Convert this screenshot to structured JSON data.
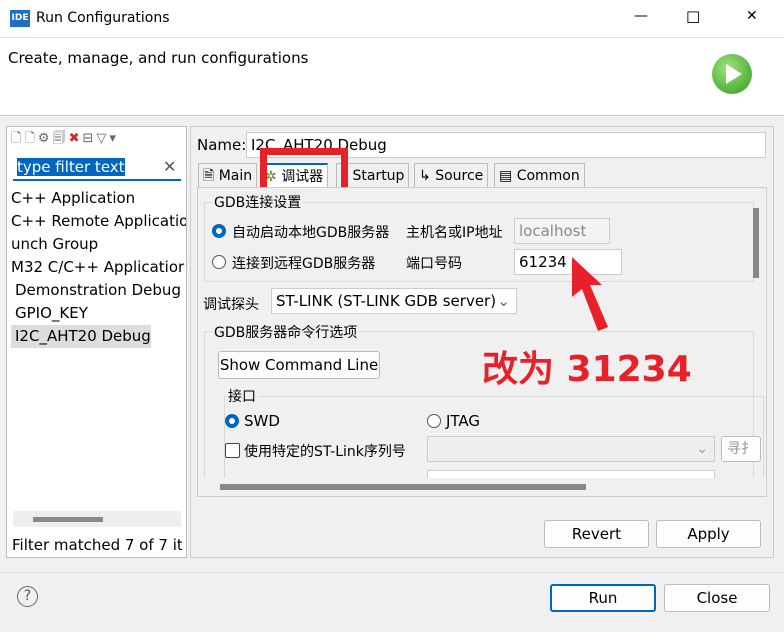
{
  "window": {
    "title": "Run Configurations",
    "icon": "IDE",
    "minimize": "—",
    "maximize": "☐",
    "close": "✕"
  },
  "banner": {
    "text": "Create, manage, and run configurations",
    "icon": "run-icon"
  },
  "sidebar": {
    "filter_placeholder": "type filter text",
    "filter_value": "type filter text",
    "items": [
      "C++ Application",
      "C++ Remote Applicatio",
      "unch Group",
      "M32 C/C++ Applicatior",
      "Demonstration Debug",
      "GPIO_KEY",
      "I2C_AHT20 Debug"
    ],
    "status": "Filter matched 7 of 7 ite"
  },
  "name": {
    "label": "Name:",
    "value": "I2C_AHT20 Debug"
  },
  "tabs": [
    "Main",
    "调试器",
    "Startup",
    "Source",
    "Common"
  ],
  "gdb_conn": {
    "title": "GDB连接设置",
    "auto_label": "自动启动本地GDB服务器",
    "remote_label": "连接到远程GDB服务器",
    "host_label": "主机名或IP地址",
    "host_value": "localhost",
    "port_label": "端口号码",
    "port_value": "61234"
  },
  "probe": {
    "label": "调试探头",
    "value": "ST-LINK (ST-LINK GDB server)"
  },
  "cmd": {
    "title": "GDB服务器命令行选项",
    "show_button": "Show Command Line",
    "iface_title": "接口",
    "swd": "SWD",
    "jtag": "JTAG",
    "serial_label": "使用特定的ST-Link序列号",
    "scan": "寻扌"
  },
  "annotation": {
    "text": "改为 31234",
    "color": "#e8202a"
  },
  "buttons": {
    "revert": "Revert",
    "apply": "Apply",
    "run": "Run",
    "close": "Close",
    "help": "?"
  }
}
